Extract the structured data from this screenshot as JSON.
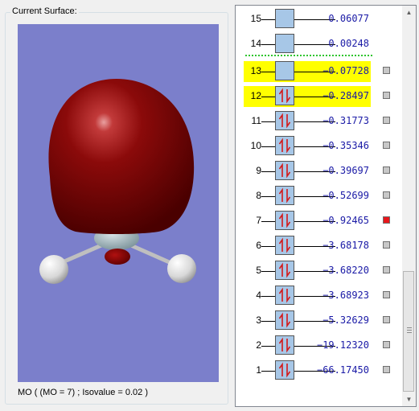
{
  "surface_panel": {
    "title": "Current Surface:",
    "caption": "MO ( (MO = 7) ; Isovalue = 0.02 )"
  },
  "orbitals": [
    {
      "number": "15",
      "energy": "0.06077",
      "occupied": false,
      "highlighted": false,
      "checkbox_color": null
    },
    {
      "number": "14",
      "energy": "0.00248",
      "occupied": false,
      "highlighted": false,
      "checkbox_color": null
    },
    {
      "number": "13",
      "energy": "−0.07728",
      "occupied": false,
      "highlighted": true,
      "checkbox_color": "#c8c8c8"
    },
    {
      "number": "12",
      "energy": "−0.28497",
      "occupied": true,
      "highlighted": true,
      "checkbox_color": "#c8c8c8"
    },
    {
      "number": "11",
      "energy": "−0.31773",
      "occupied": true,
      "highlighted": false,
      "checkbox_color": "#c8c8c8"
    },
    {
      "number": "10",
      "energy": "−0.35346",
      "occupied": true,
      "highlighted": false,
      "checkbox_color": "#c8c8c8"
    },
    {
      "number": "9",
      "energy": "−0.39697",
      "occupied": true,
      "highlighted": false,
      "checkbox_color": "#c8c8c8"
    },
    {
      "number": "8",
      "energy": "−0.52699",
      "occupied": true,
      "highlighted": false,
      "checkbox_color": "#c8c8c8"
    },
    {
      "number": "7",
      "energy": "−0.92465",
      "occupied": true,
      "highlighted": false,
      "checkbox_color": "#e8161b"
    },
    {
      "number": "6",
      "energy": "−3.68178",
      "occupied": true,
      "highlighted": false,
      "checkbox_color": "#c8c8c8"
    },
    {
      "number": "5",
      "energy": "−3.68220",
      "occupied": true,
      "highlighted": false,
      "checkbox_color": "#c8c8c8"
    },
    {
      "number": "4",
      "energy": "−3.68923",
      "occupied": true,
      "highlighted": false,
      "checkbox_color": "#c8c8c8"
    },
    {
      "number": "3",
      "energy": "−5.32629",
      "occupied": true,
      "highlighted": false,
      "checkbox_color": "#c8c8c8"
    },
    {
      "number": "2",
      "energy": "−19.12320",
      "occupied": true,
      "highlighted": false,
      "checkbox_color": "#c8c8c8"
    },
    {
      "number": "1",
      "energy": "−66.17450",
      "occupied": true,
      "highlighted": false,
      "checkbox_color": "#c8c8c8"
    }
  ],
  "colors": {
    "highlight": "#ffff00",
    "homo_lumo_separator": "#2fc52f",
    "energy_text": "#1a1aa6",
    "orbital_box": "#a7c7e7",
    "electron_arrow": "#d41a1a",
    "viewer_background": "#7b7fcb",
    "positive_lobe": "#8b0000"
  },
  "scrollbar": {
    "up_icon": "scroll-up-arrow-icon",
    "down_icon": "scroll-down-arrow-icon"
  }
}
